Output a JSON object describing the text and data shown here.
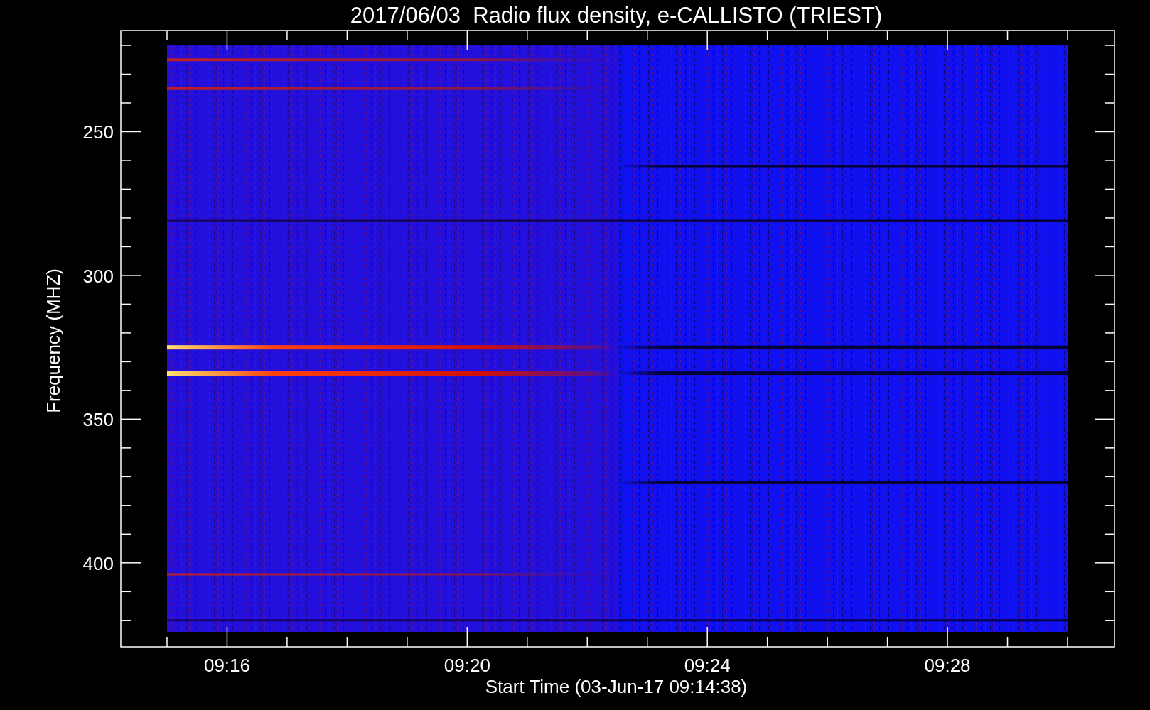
{
  "title": "2017/06/03  Radio flux density, e-CALLISTO (TRIEST)",
  "y_axis": {
    "label": "Frequency (MHZ)",
    "ticks": [
      "250",
      "300",
      "350",
      "400"
    ]
  },
  "x_axis": {
    "label": "Start Time (03-Jun-17 09:14:38)",
    "ticks": [
      "09:16",
      "09:20",
      "09:24",
      "09:28"
    ]
  }
}
